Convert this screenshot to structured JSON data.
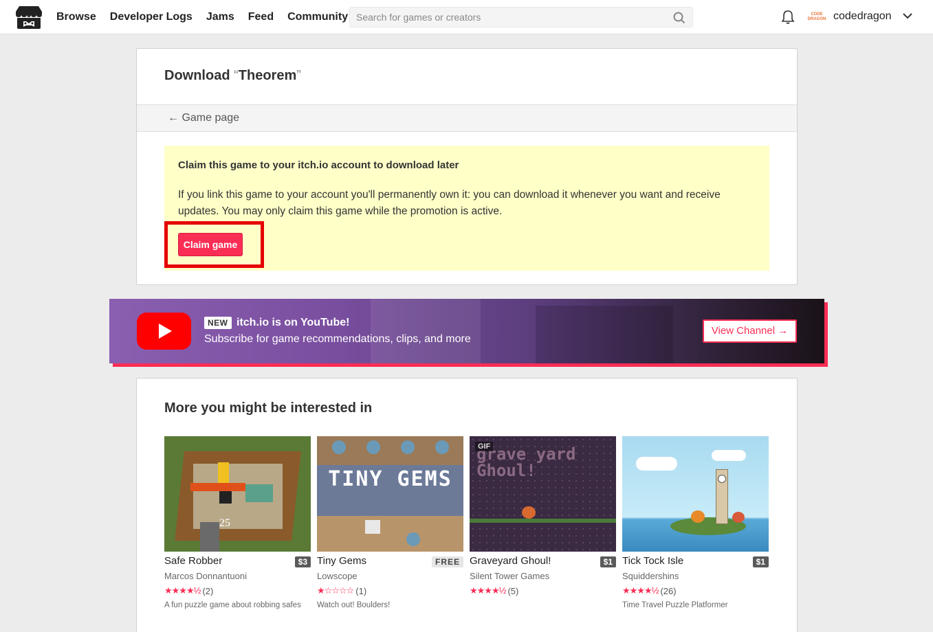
{
  "header": {
    "nav": [
      "Browse",
      "Developer Logs",
      "Jams",
      "Feed",
      "Community"
    ],
    "search_placeholder": "Search for games or creators",
    "avatar_text": [
      "CODE",
      "DRAGON"
    ],
    "username": "codedragon"
  },
  "download": {
    "title_prefix": "Download ",
    "open_quote": "“",
    "game_title": "Theorem",
    "close_quote": "”",
    "back_link": "← Game page",
    "claim_heading": "Claim this game to your itch.io account to download later",
    "claim_text": "If you link this game to your account you'll permanently own it: you can download it whenever you want and receive updates. You may only claim this game while the promotion is active.",
    "claim_button": "Claim game"
  },
  "youtube": {
    "badge": "NEW",
    "title": "itch.io is on YouTube!",
    "subtitle": "Subscribe for game recommendations, clips, and more",
    "button": "View Channel →"
  },
  "more": {
    "heading": "More you might be interested in",
    "games": [
      {
        "name": "Safe Robber",
        "price": "$3",
        "author": "Marcos Donnantuoni",
        "stars": "★★★★½",
        "count": "(2)",
        "desc": "A fun puzzle game about robbing safes",
        "thumb_text": "25"
      },
      {
        "name": "Tiny Gems",
        "price": "FREE",
        "author": "Lowscope",
        "stars": "★☆☆☆☆",
        "count": "(1)",
        "desc": "Watch out! Boulders!",
        "thumb_text": "TINY GEMS"
      },
      {
        "name": "Graveyard Ghoul!",
        "price": "$1",
        "author": "Silent Tower Games",
        "stars": "★★★★½",
        "count": "(5)",
        "desc": "",
        "thumb_text": "grave yard Ghoul!",
        "gif": "GIF"
      },
      {
        "name": "Tick Tock Isle",
        "price": "$1",
        "author": "Squiddershins",
        "stars": "★★★★½",
        "count": "(26)",
        "desc": "Time Travel Puzzle Platformer",
        "thumb_text": ""
      }
    ]
  },
  "colors": {
    "accent": "#fa2d55",
    "highlight": "#e60000",
    "claim_bg": "#ffffc8"
  }
}
